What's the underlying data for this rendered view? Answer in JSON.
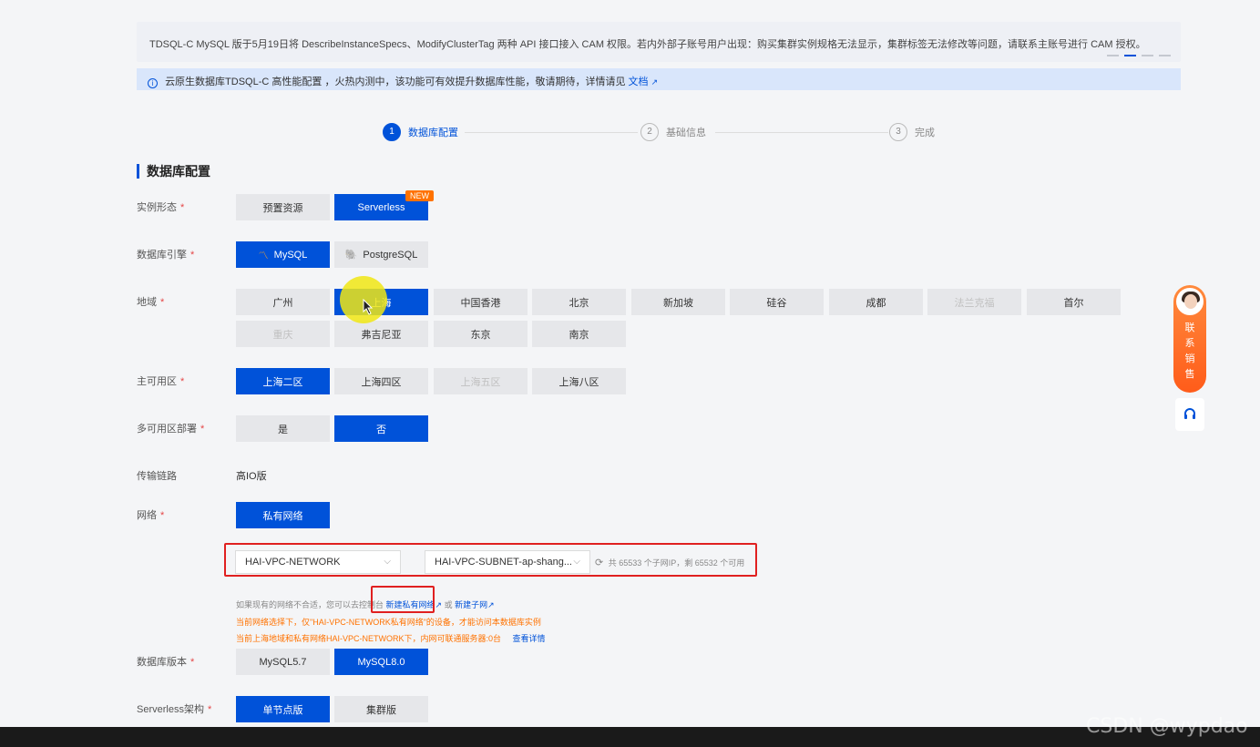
{
  "notice": {
    "text": "TDSQL-C MySQL 版于5月19日将 DescribeInstanceSpecs、ModifyClusterTag 两种 API 接口接入 CAM 权限。若内外部子账号用户出现：购买集群实例规格无法显示，集群标签无法修改等问题，请联系主账号进行 CAM 授权。"
  },
  "info": {
    "text": "云原生数据库TDSQL-C 高性能配置 ，火热内测中，该功能可有效提升数据库性能，敬请期待，详情请见",
    "link": "文档"
  },
  "steps": [
    {
      "num": "1",
      "label": "数据库配置"
    },
    {
      "num": "2",
      "label": "基础信息"
    },
    {
      "num": "3",
      "label": "完成"
    }
  ],
  "section_title": "数据库配置",
  "form": {
    "instance_type": {
      "label": "实例形态",
      "options": [
        "预置资源",
        "Serverless"
      ],
      "badge": "NEW"
    },
    "engine": {
      "label": "数据库引擎",
      "options": [
        "MySQL",
        "PostgreSQL"
      ]
    },
    "region": {
      "label": "地域",
      "row1": [
        "广州",
        "上海",
        "中国香港",
        "北京",
        "新加坡",
        "硅谷",
        "成都",
        "法兰克福",
        "首尔"
      ],
      "row2": [
        "重庆",
        "弗吉尼亚",
        "东京",
        "南京"
      ]
    },
    "zone": {
      "label": "主可用区",
      "options": [
        "上海二区",
        "上海四区",
        "上海五区",
        "上海八区"
      ]
    },
    "multi_az": {
      "label": "多可用区部署",
      "options": [
        "是",
        "否"
      ]
    },
    "link": {
      "label": "传输链路",
      "value": "高IO版"
    },
    "network": {
      "label": "网络",
      "type": "私有网络",
      "vpc": "HAI-VPC-NETWORK",
      "subnet": "HAI-VPC-SUBNET-ap-shang...",
      "ip_info": "共 65533 个子网IP，剩 65532 个可用",
      "hint1": "如果现有的网络不合适，您可以去控制台",
      "hint1_link1": "新建私有网络",
      "hint1_mid": "或",
      "hint1_link2": "新建子网",
      "hint2": "当前网络选择下，仅\"HAI-VPC-NETWORK私有网络\"的设备，才能访问本数据库实例",
      "hint3": "当前上海地域和私有网络HAI-VPC-NETWORK下，内网可联通服务器:0台",
      "hint3_link": "查看详情"
    },
    "version": {
      "label": "数据库版本",
      "options": [
        "MySQL5.7",
        "MySQL8.0"
      ]
    },
    "serverless_arch": {
      "label": "Serverless架构",
      "options": [
        "单节点版",
        "集群版"
      ]
    }
  },
  "sidebar": {
    "sales": "联系销售"
  },
  "watermark": "CSDN @wypdao",
  "colors": {
    "accent": "#0052d9",
    "warning": "#ff7200",
    "highlight": "#e02020"
  }
}
